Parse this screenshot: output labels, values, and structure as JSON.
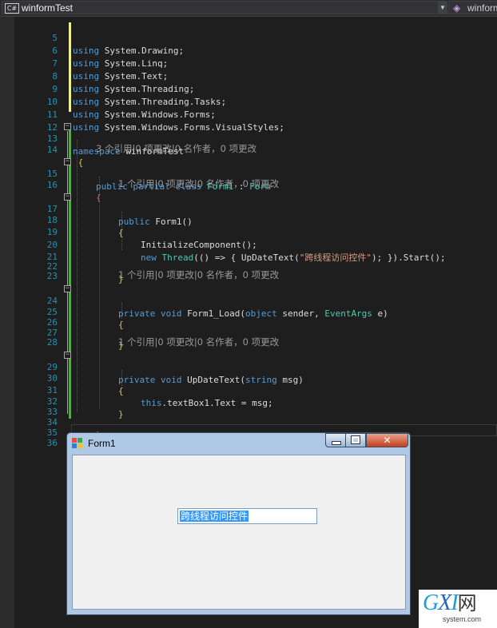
{
  "toolbar": {
    "file_badge": "C#",
    "file_combo": "winformTest",
    "member_combo": "winform"
  },
  "editor": {
    "lines": [
      {
        "n": "5",
        "kw": "using",
        "rest": " System.Drawing;"
      },
      {
        "n": "6",
        "kw": "using",
        "rest": " System.Linq;"
      },
      {
        "n": "7",
        "kw": "using",
        "rest": " System.Text;"
      },
      {
        "n": "8",
        "kw": "using",
        "rest": " System.Threading;"
      },
      {
        "n": "9",
        "kw": "using",
        "rest": " System.Threading.Tasks;"
      },
      {
        "n": "10",
        "kw": "using",
        "rest": " System.Windows.Forms;"
      },
      {
        "n": "11",
        "kw": "using",
        "rest": " System.Windows.Forms.VisualStyles;"
      },
      {
        "n": "12"
      },
      {
        "n": "13",
        "kw": "namespace",
        "rest": " winformTest"
      },
      {
        "n": "14",
        "rest": " {"
      },
      {
        "n": "15",
        "kw": "public partial class",
        "ty": "Form1",
        "rest": " : ",
        "ty2": "Form"
      },
      {
        "n": "16",
        "rest": "{"
      },
      {
        "n": "17",
        "kw": "public",
        "rest": " Form1()"
      },
      {
        "n": "18",
        "rest": "{"
      },
      {
        "n": "19",
        "rest": "InitializeComponent();"
      },
      {
        "n": "20",
        "kw": "new",
        "ty": "Thread",
        "rest": "(() => { UpDateText(",
        "str": "\"跨线程访问控件\"",
        "rest2": "); }).Start();"
      },
      {
        "n": "21"
      },
      {
        "n": "22",
        "rest": "}"
      },
      {
        "n": "23"
      },
      {
        "n": "24",
        "kw": "private void",
        "rest": " Form1_Load(",
        "kw2": "object",
        "rest2": " sender, ",
        "ty": "EventArgs",
        "rest3": " e)"
      },
      {
        "n": "25",
        "rest": "{"
      },
      {
        "n": "26"
      },
      {
        "n": "27",
        "rest": "}"
      },
      {
        "n": "28"
      },
      {
        "n": "29",
        "kw": "private void",
        "rest": " UpDateText(",
        "kw2": "string",
        "rest2": " msg)"
      },
      {
        "n": "30",
        "rest": "{"
      },
      {
        "n": "31",
        "kw": "this",
        "rest": ".textBox1.Text = msg;"
      },
      {
        "n": "32",
        "rest": "}"
      },
      {
        "n": "33"
      },
      {
        "n": "34",
        "rest": "}"
      },
      {
        "n": "35",
        "rest": "}"
      },
      {
        "n": "36"
      }
    ],
    "codelens": {
      "class": "3 个引用|0 项更改|0 名作者，0 项更改",
      "ctor": "1 个引用|0 项更改|0 名作者，0 项更改",
      "load": "1 个引用|0 项更改|0 名作者，0 项更改",
      "update": "1 个引用|0 项更改|0 名作者，0 项更改"
    }
  },
  "form": {
    "title": "Form1",
    "textbox_value": "跨线程访问控件",
    "close_glyph": "✕",
    "max_glyph": "□",
    "min_glyph": "_"
  },
  "watermark": {
    "logo_g": "G",
    "logo_x": "X",
    "logo_i": "I",
    "logo_net": "网",
    "site": "system.com"
  }
}
